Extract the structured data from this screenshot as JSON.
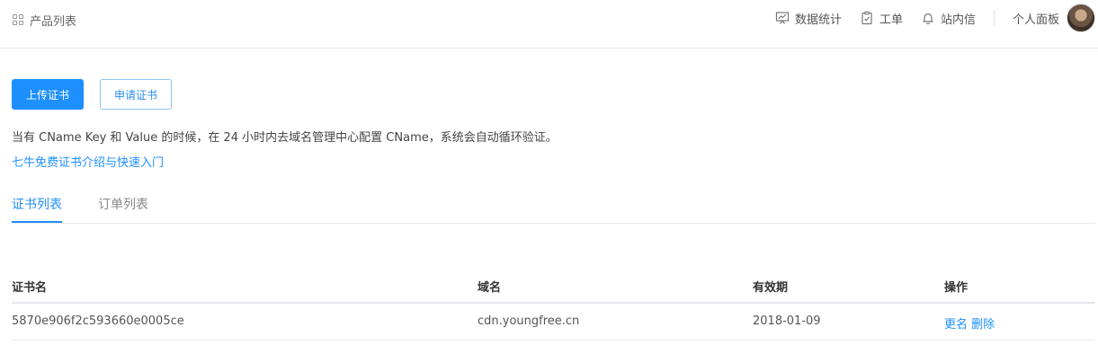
{
  "header": {
    "breadcrumb_icon": "grid-icon",
    "breadcrumb": "产品列表",
    "nav": [
      {
        "label": "数据统计",
        "icon": "chart-icon"
      },
      {
        "label": "工单",
        "icon": "clipboard-icon"
      },
      {
        "label": "站内信",
        "icon": "bell-icon"
      }
    ],
    "user_panel": "个人面板"
  },
  "actions": {
    "upload": "上传证书",
    "apply": "申请证书"
  },
  "notice": "当有 CName Key 和 Value 的时候，在 24 小时内去域名管理中心配置 CName，系统会自动循环验证。",
  "intro_link": "七牛免费证书介绍与快速入门",
  "tabs": [
    {
      "label": "证书列表",
      "active": true
    },
    {
      "label": "订单列表",
      "active": false
    }
  ],
  "table": {
    "headers": [
      "证书名",
      "域名",
      "有效期",
      "操作"
    ],
    "rows": [
      {
        "name": "5870e906f2c593660e0005ce",
        "domain": "cdn.youngfree.cn",
        "expiry": "2018-01-09",
        "rename": "更名",
        "delete": "删除"
      }
    ]
  },
  "colors": {
    "accent": "#1e8fff",
    "border": "#e8e8e8"
  }
}
